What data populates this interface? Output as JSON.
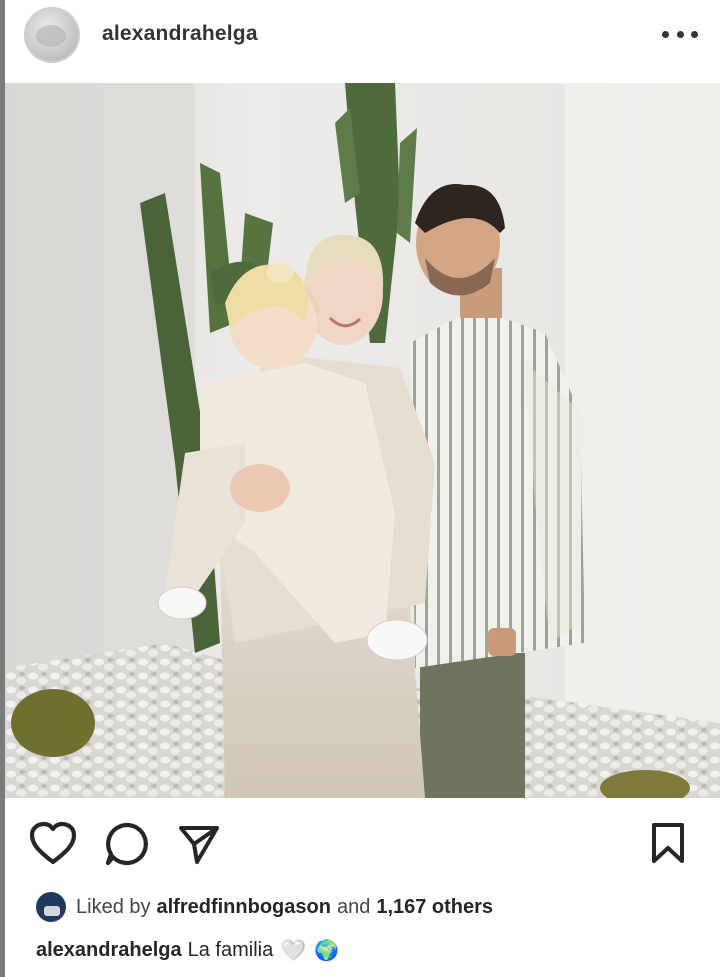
{
  "post": {
    "username": "alexandrahelga",
    "more_icon": "more-horizontal-icon",
    "avatar_icon": "profile-avatar"
  },
  "actions": {
    "like_icon": "heart-icon",
    "comment_icon": "comment-icon",
    "share_icon": "paper-plane-icon",
    "save_icon": "bookmark-icon"
  },
  "likes": {
    "prefix": "Liked by",
    "liker": "alfredfinnbogason",
    "and": "and",
    "others": "1,167 others"
  },
  "caption": {
    "username": "alexandrahelga",
    "text": "La familia",
    "emoji_1": "🤍",
    "emoji_2": "🌍"
  },
  "colors": {
    "text": "#262626",
    "wall": "#e8e6e3",
    "cactus": "#4f6a3c"
  }
}
